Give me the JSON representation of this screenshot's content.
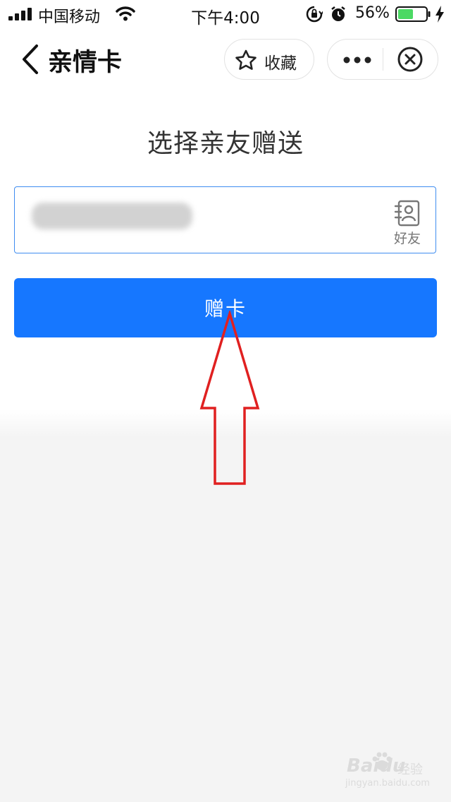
{
  "status_bar": {
    "carrier": "中国移动",
    "time": "下午4:00",
    "battery_percent": "56%",
    "battery_level": 0.56,
    "signal-icon": "signal-bars",
    "wifi-icon": "wifi",
    "lock_icon": "rotation-lock",
    "alarm_icon": "alarm-clock",
    "charging_icon": "lightning-bolt"
  },
  "nav": {
    "back_icon": "chevron-left",
    "title": "亲情卡",
    "favorite_label": "收藏",
    "favorite_icon": "star-outline",
    "more_icon": "three-dots",
    "close_icon": "circle-x"
  },
  "main": {
    "heading": "选择亲友赠送",
    "recipient": {
      "value": "",
      "friends_label": "好友",
      "friends_icon": "contacts-book"
    },
    "gift_button_label": "赠卡"
  },
  "colors": {
    "primary": "#1677ff",
    "input_border": "#3f8df0",
    "annotation_arrow": "#e02020",
    "battery_fill": "#4cd964",
    "background": "#f4f4f4"
  },
  "watermark": {
    "brand": "Baidu",
    "sub": "经验",
    "url": "jingyan.baidu.com"
  }
}
